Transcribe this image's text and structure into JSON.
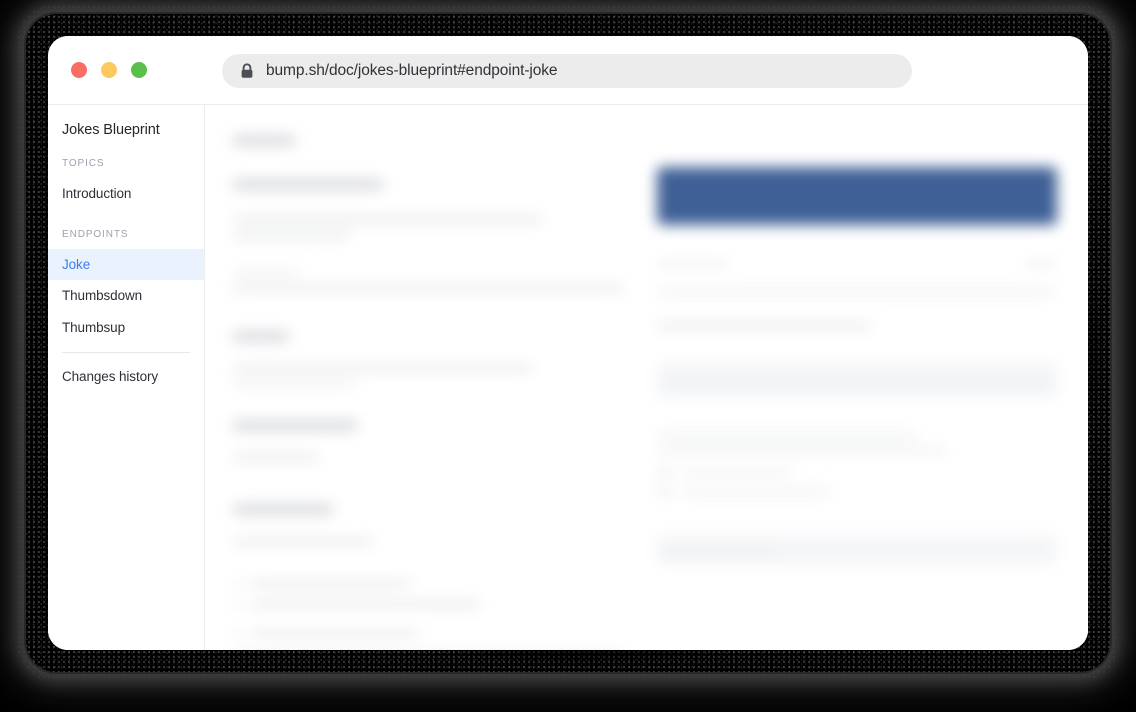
{
  "window": {
    "traffic_lights": [
      {
        "name": "close",
        "color": "#FA6D63"
      },
      {
        "name": "minimize",
        "color": "#FCC95E"
      },
      {
        "name": "maximize",
        "color": "#5BBF4B"
      }
    ],
    "url": "bump.sh/doc/jokes-blueprint#endpoint-joke",
    "lock_icon": "padlock-icon"
  },
  "sidebar": {
    "doc_title": "Jokes Blueprint",
    "sections": [
      {
        "label": "TOPICS",
        "items": [
          {
            "label": "Introduction",
            "active": false
          }
        ]
      },
      {
        "label": "ENDPOINTS",
        "items": [
          {
            "label": "Joke",
            "active": true
          },
          {
            "label": "Thumbsdown",
            "active": false
          },
          {
            "label": "Thumbsup",
            "active": false
          }
        ]
      }
    ],
    "footer_items": [
      {
        "label": "Changes history",
        "active": false
      }
    ],
    "active_color": "#3d7ef0",
    "active_bg": "#eaf2fd"
  },
  "main": {
    "state": "blurred-document",
    "accent_block_color": "#3f6096"
  }
}
